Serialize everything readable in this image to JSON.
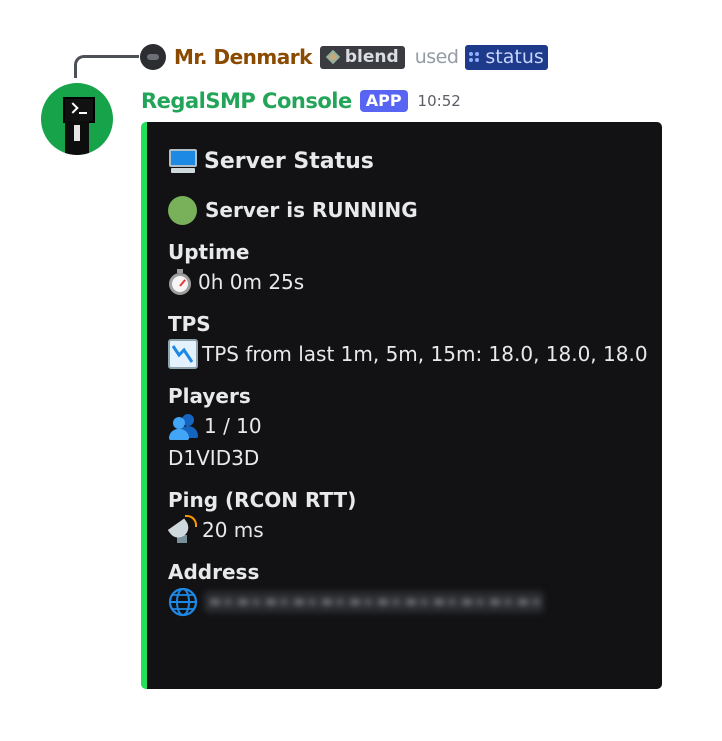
{
  "reply": {
    "username": "Mr. Denmark",
    "server_tag": "blend",
    "used_text": "used",
    "command": "status"
  },
  "message": {
    "bot_name": "RegalSMP Console",
    "badge": "APP",
    "timestamp": "10:52"
  },
  "embed": {
    "accent_color": "#23e05a",
    "title_icon": "desktop-computer-icon",
    "title": "Server Status",
    "status_icon": "green-circle-icon",
    "status": "Server is RUNNING",
    "fields": {
      "uptime": {
        "name": "Uptime",
        "icon": "stopwatch-icon",
        "value": "0h 0m 25s"
      },
      "tps": {
        "name": "TPS",
        "icon": "chart-decreasing-icon",
        "value": "TPS from last 1m, 5m, 15m: 18.0, 18.0, 18.0"
      },
      "players": {
        "name": "Players",
        "icon": "busts-in-silhouette-icon",
        "value": "1 / 10",
        "list": "D1VID3D"
      },
      "ping": {
        "name": "Ping (RCON RTT)",
        "icon": "satellite-antenna-icon",
        "value": "20 ms"
      },
      "address": {
        "name": "Address",
        "icon": "globe-icon"
      }
    }
  }
}
